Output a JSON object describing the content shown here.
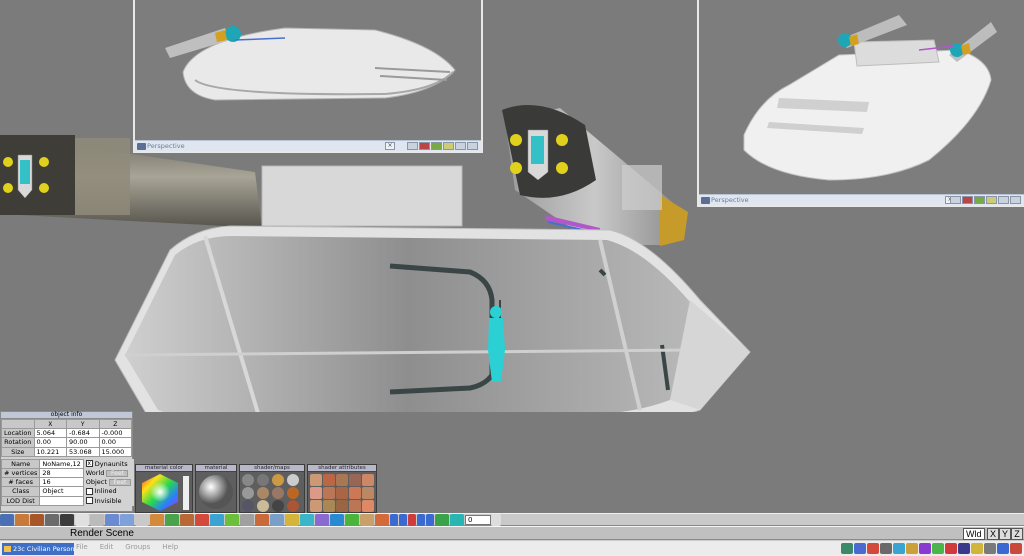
{
  "viewports": {
    "top_center": {
      "label": "Perspective"
    },
    "top_right": {
      "label": "Perspective"
    }
  },
  "object_info": {
    "title": "object info",
    "headers": [
      "X",
      "Y",
      "Z"
    ],
    "location": {
      "label": "Location",
      "x": "5.064",
      "y": "-0.684",
      "z": "-0.000"
    },
    "rotation": {
      "label": "Rotation",
      "x": "0.00",
      "y": "90.00",
      "z": "0.00"
    },
    "size": {
      "label": "Size",
      "x": "10.221",
      "y": "53.068",
      "z": "15.000"
    },
    "name": {
      "label": "Name",
      "value": "NoName,12",
      "dynaunits": "Dynaunits"
    },
    "vertices": {
      "label": "# vertices",
      "value": "28",
      "world": "World",
      "world_unit": "Feet"
    },
    "faces": {
      "label": "# faces",
      "value": "16",
      "object": "Object",
      "object_unit": "Feet"
    },
    "class": {
      "label": "Class",
      "value": "Object",
      "inlined": "Inlined"
    },
    "lod": {
      "label": "LOD Dist",
      "invisible": "Invisible"
    }
  },
  "panels": {
    "material_color": "material color",
    "material": "material",
    "shader_maps": "shader/maps",
    "shader_attributes": "shader attributes"
  },
  "frame_field": "0",
  "status": {
    "text": "Render Scene",
    "right_label": "Wld",
    "x": "X",
    "y": "Y",
    "z": "Z"
  },
  "taskbar": {
    "task": "23c Civilian Personal...",
    "menu": [
      "File",
      "Edit",
      "Groups",
      "Help"
    ]
  },
  "colors": {
    "background": "#7b7b7b",
    "figure": "#2ad0d4",
    "hull": "#e6e6e6"
  }
}
